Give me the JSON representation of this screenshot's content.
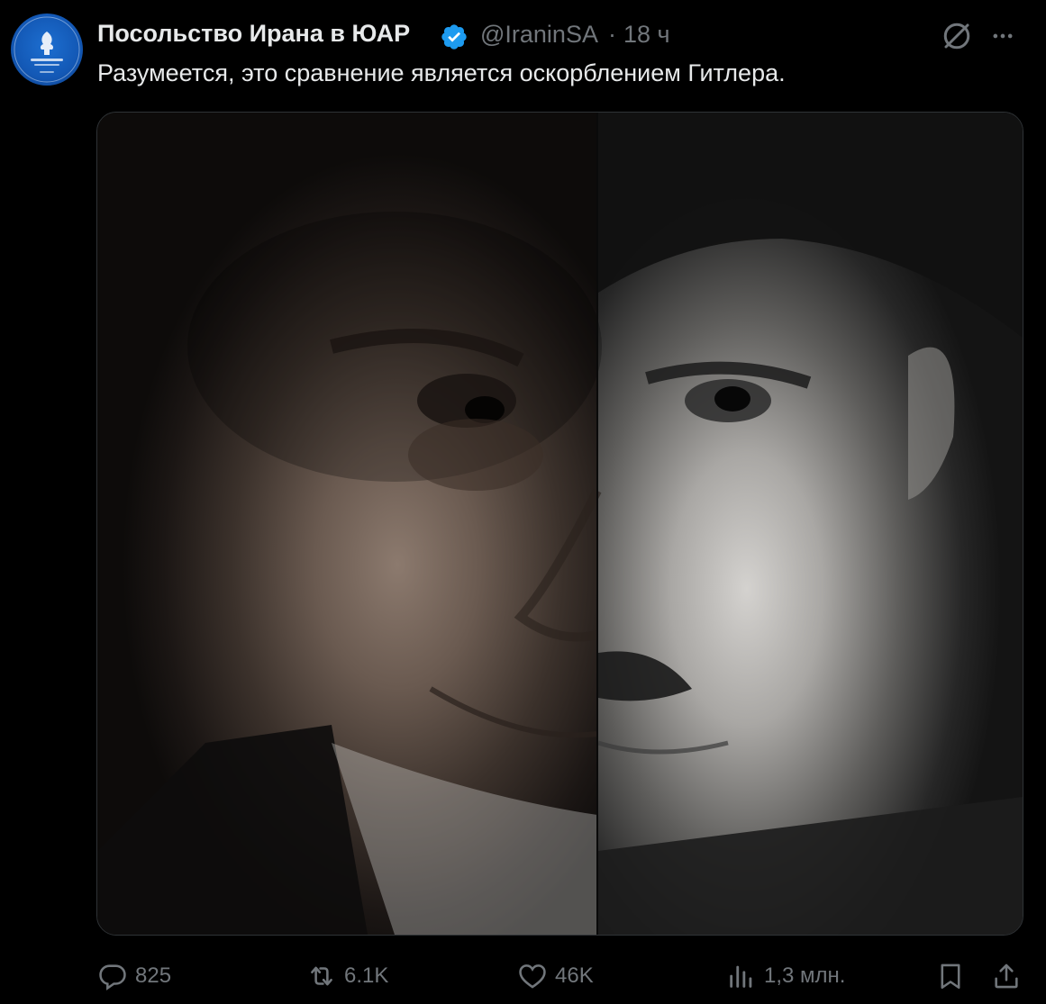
{
  "tweet": {
    "author_name": "Посольство Ирана в ЮАР",
    "handle": "@IraninSA",
    "separator": "·",
    "time": "18 ч",
    "text": "Разумеется, это сравнение является оскорблением Гитлера."
  },
  "actions": {
    "replies": "825",
    "retweets": "6.1K",
    "likes": "46K",
    "views": "1,3 млн."
  },
  "icons": {
    "verified": "verified-badge-icon",
    "grok": "grok-icon",
    "more": "more-icon",
    "reply": "reply-icon",
    "retweet": "retweet-icon",
    "like": "like-icon",
    "views": "views-icon",
    "bookmark": "bookmark-icon",
    "share": "share-icon"
  },
  "colors": {
    "background": "#000000",
    "text_primary": "#e7e9ea",
    "text_secondary": "#71767b",
    "verified_blue": "#1d9bf0"
  }
}
